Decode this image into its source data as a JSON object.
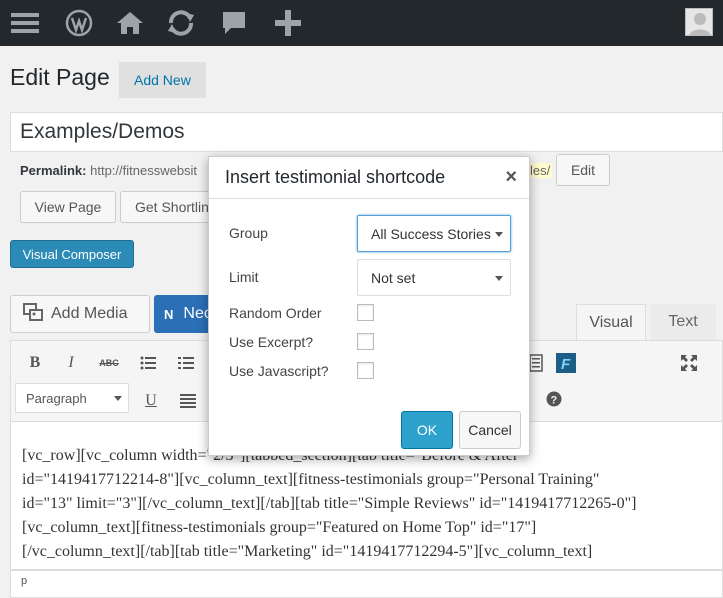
{
  "adminbar": {
    "icons": [
      "menu-icon",
      "wordpress-icon",
      "home-icon",
      "refresh-icon",
      "comment-icon",
      "plus-icon",
      "avatar"
    ]
  },
  "header": {
    "title": "Edit Page",
    "add_new": "Add New"
  },
  "post": {
    "title_value": "Examples/Demos",
    "permalink_label": "Permalink:",
    "permalink_url": "http://fitnesswebsit",
    "permalink_tail": "les/",
    "edit_label": "Edit",
    "view_label": "View Page",
    "shortlink_label": "Get Shortlin"
  },
  "visual_composer": {
    "label": "Visual Composer"
  },
  "media": {
    "add_media": "Add Media",
    "neo_label": "Nec"
  },
  "editor_tabs": {
    "visual": "Visual",
    "text": "Text"
  },
  "toolbar": {
    "format_value": "Paragraph"
  },
  "editor": {
    "lines": [
      "[vc_row][vc_column width=\"2/3\"][tabbed_section][tab title=\"Before & After\"",
      "id=\"1419417712214-8\"][vc_column_text][fitness-testimonials group=\"Personal Training\"",
      "id=\"13\" limit=\"3\"][/vc_column_text][/tab][tab title=\"Simple Reviews\" id=\"1419417712265-0\"]",
      "[vc_column_text][fitness-testimonials group=\"Featured on Home Top\" id=\"17\"]",
      "[/vc_column_text][/tab][tab title=\"Marketing\" id=\"1419417712294-5\"][vc_column_text]"
    ],
    "path": "p"
  },
  "modal": {
    "title": "Insert testimonial shortcode",
    "close": "×",
    "group_label": "Group",
    "group_value": "All Success Stories",
    "limit_label": "Limit",
    "limit_value": "Not set",
    "random_label": "Random Order",
    "excerpt_label": "Use Excerpt?",
    "javascript_label": "Use Javascript?",
    "ok": "OK",
    "cancel": "Cancel"
  },
  "colors": {
    "adminbar": "#23282d",
    "primary_button": "#2ea2cc",
    "visual_composer": "#2b8ab6",
    "link": "#0073aa"
  }
}
